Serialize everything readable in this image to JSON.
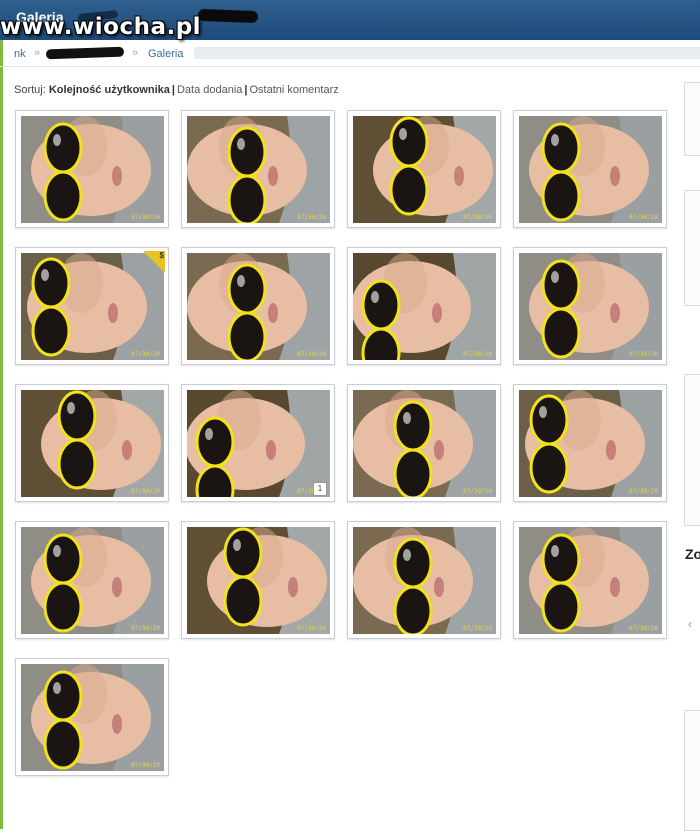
{
  "header": {
    "title": "Galeria"
  },
  "watermark": "www.wiocha.pl",
  "breadcrumb": {
    "items": [
      "nk",
      "Galeria"
    ],
    "separator": "»"
  },
  "sort": {
    "label": "Sortuj:",
    "active": "Kolejność użytkownika",
    "options": [
      "Data dodania",
      "Ostatni komentarz"
    ]
  },
  "photos": [
    {
      "variant": "a"
    },
    {
      "variant": "b"
    },
    {
      "variant": "c"
    },
    {
      "variant": "a"
    },
    {
      "variant": "d",
      "corner": "$"
    },
    {
      "variant": "b"
    },
    {
      "variant": "e"
    },
    {
      "variant": "a"
    },
    {
      "variant": "c"
    },
    {
      "variant": "e",
      "comments": "1"
    },
    {
      "variant": "b"
    },
    {
      "variant": "d"
    },
    {
      "variant": "a"
    },
    {
      "variant": "c"
    },
    {
      "variant": "b"
    },
    {
      "variant": "a"
    },
    {
      "variant": "a"
    }
  ],
  "photo_date_stamp": "07/30/20",
  "sidebar": {
    "heading": "Zo",
    "arrow": "‹"
  },
  "colors": {
    "header": "#1e4b7a",
    "link": "#3b6e9d",
    "accent_green": "#7cbe3c",
    "glasses_frame": "#f2e21b"
  }
}
